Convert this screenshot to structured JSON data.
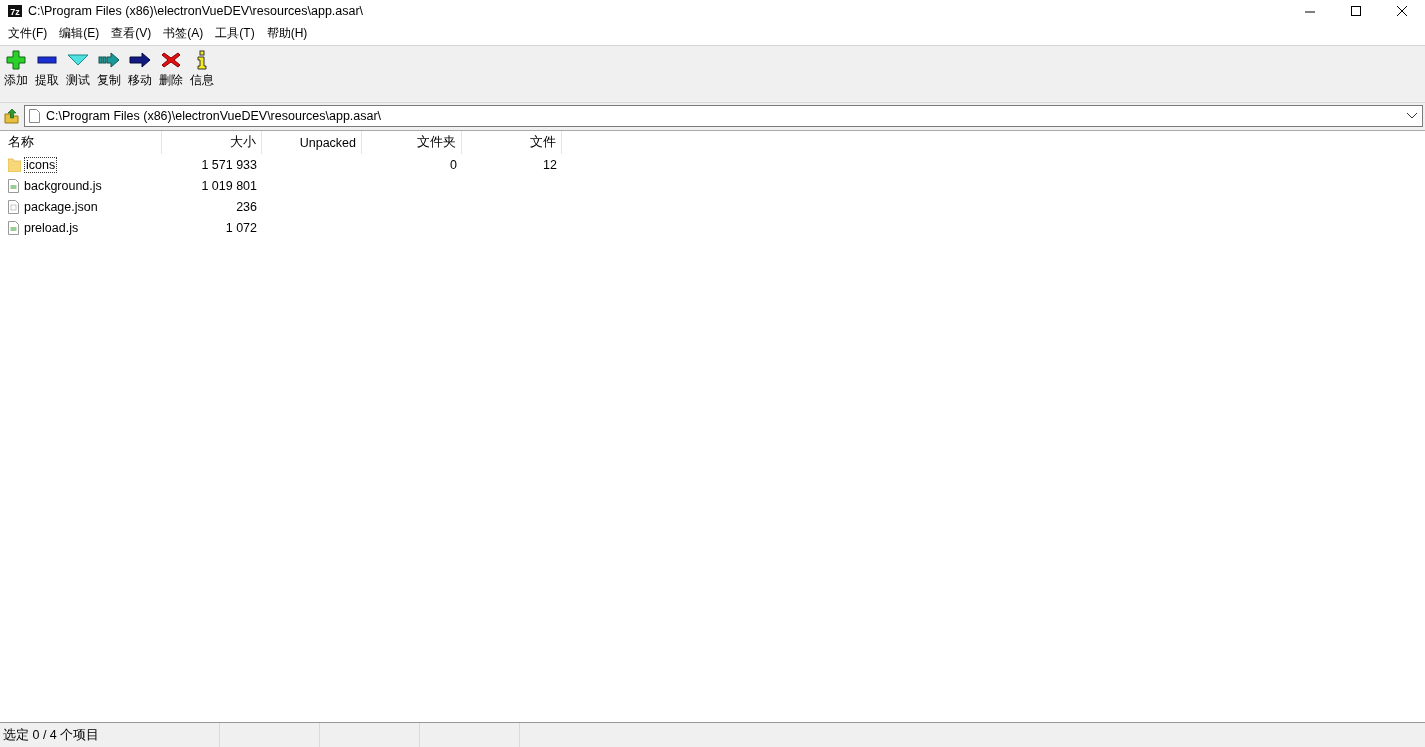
{
  "window": {
    "icon_text": "7z",
    "title": "C:\\Program Files (x86)\\electronVueDEV\\resources\\app.asar\\"
  },
  "menu": [
    "文件(F)",
    "编辑(E)",
    "查看(V)",
    "书签(A)",
    "工具(T)",
    "帮助(H)"
  ],
  "toolbar": [
    {
      "kind": "add",
      "label": "添加"
    },
    {
      "kind": "extract",
      "label": "提取"
    },
    {
      "kind": "test",
      "label": "测试"
    },
    {
      "kind": "copy",
      "label": "复制"
    },
    {
      "kind": "move",
      "label": "移动"
    },
    {
      "kind": "delete",
      "label": "删除"
    },
    {
      "kind": "info",
      "label": "信息"
    }
  ],
  "address": {
    "value": "C:\\Program Files (x86)\\electronVueDEV\\resources\\app.asar\\"
  },
  "table": {
    "columns": [
      "名称",
      "大小",
      "Unpacked",
      "文件夹",
      "文件"
    ],
    "rows": [
      {
        "kind": "folder",
        "focused": true,
        "cells": [
          "icons",
          "1 571 933",
          "",
          "0",
          "12"
        ]
      },
      {
        "kind": "js",
        "focused": false,
        "cells": [
          "background.js",
          "1 019 801",
          "",
          "",
          ""
        ]
      },
      {
        "kind": "json",
        "focused": false,
        "cells": [
          "package.json",
          "236",
          "",
          "",
          ""
        ]
      },
      {
        "kind": "js",
        "focused": false,
        "cells": [
          "preload.js",
          "1 072",
          "",
          "",
          ""
        ]
      }
    ]
  },
  "status_bar": {
    "text": "选定 0 / 4 个项目"
  }
}
